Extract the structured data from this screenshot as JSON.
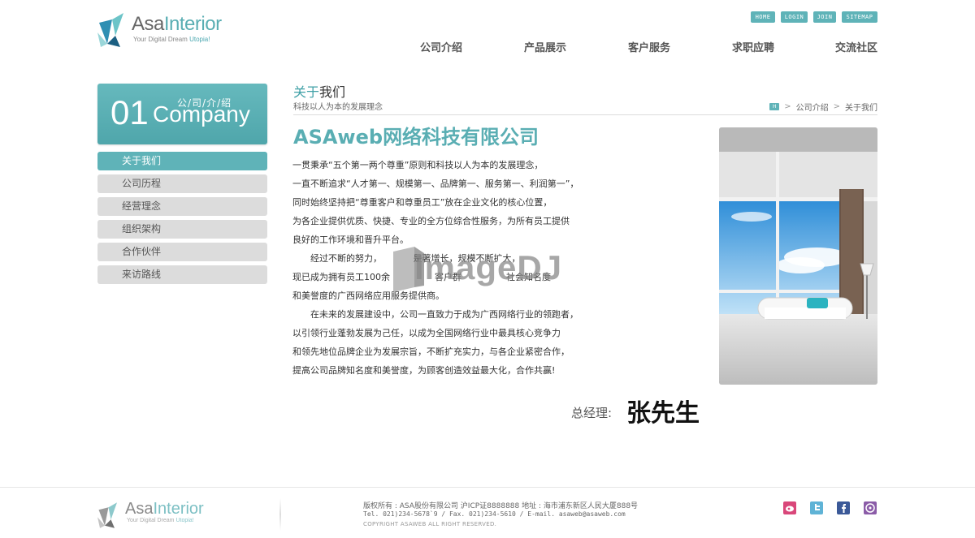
{
  "header": {
    "brand_prefix": "Asa",
    "brand_suffix": "Interior",
    "tagline_prefix": "Your Digital Dream ",
    "tagline_accent": "Utopia!",
    "utility_links": [
      "HOME",
      "LOGIN",
      "JOIN",
      "SITEMAP"
    ],
    "nav": [
      "公司介绍",
      "产品展示",
      "客户服务",
      "求职应聘",
      "交流社区"
    ]
  },
  "sidebar": {
    "banner_number": "01",
    "banner_en": "Company",
    "banner_cn": "公/司/介/绍",
    "items": [
      "关于我们",
      "公司历程",
      "经营理念",
      "组织架构",
      "合作伙伴",
      "来访路线"
    ]
  },
  "content": {
    "title_accent": "关于",
    "title_rest": "我们",
    "subtitle": "科技以人为本的发展理念",
    "breadcrumb": [
      "公司介绍",
      "关于我们"
    ],
    "company_name": "ASAweb网络科技有限公司",
    "paragraphs": [
      "一贯秉承“五个第一两个尊重”原则和科技以人为本的发展理念，",
      "一直不断追求“人才第一、规模第一、品牌第一、服务第一、利润第一”，",
      "同时始终坚持把“尊重客户和尊重员工”放在企业文化的核心位置，",
      "为各企业提供优质、快捷、专业的全方位综合性服务，为所有员工提供",
      "良好的工作环境和晋升平台。",
      "　　经过不断的努力，　　　　是著增长，规模不断扩大，",
      "现已成为拥有员工100余　　　　　客户群　　　　　社会知名度",
      "和美誉度的广西网络应用服务提供商。",
      "　　在未来的发展建设中，公司一直致力于成为广西网络行业的领跑者，",
      "以引领行业蓬勃发展为己任，以成为全国网络行业中最具核心竞争力",
      "和领先地位品牌企业为发展宗旨，不断扩充实力，与各企业紧密合作，",
      "提高公司品牌知名度和美誉度，为顾客创造效益最大化，合作共赢!"
    ],
    "signature_label": "总经理:",
    "signature_name": "张先生",
    "watermark": "imageDJ"
  },
  "footer": {
    "brand_prefix": "Asa",
    "brand_suffix": "Interior",
    "tagline_prefix": "Your Digital Dream ",
    "tagline_accent": "Utopia!",
    "line1": "版权所有 : ASA股份有限公司 沪ICP证8888888    地址 : 海市浦东新区人民大厦888号",
    "line2": "Tel. 021)234-5678`9  / Fax. 021)234-5610  / E-mail. asaweb@asaweb.com",
    "copyright": "COPYRIGHT ASAWEB ALL RIGHT RESERVED.",
    "social": [
      {
        "name": "weibo-icon",
        "color": "#d9477a"
      },
      {
        "name": "twitter-icon",
        "color": "#5fb3d6"
      },
      {
        "name": "facebook-icon",
        "color": "#3b5998"
      },
      {
        "name": "chat-icon",
        "color": "#8b5ca8"
      }
    ]
  }
}
